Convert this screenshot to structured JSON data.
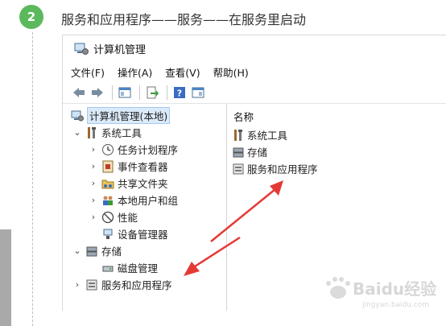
{
  "step": {
    "number": "2",
    "title": "服务和应用程序——服务——在服务里启动"
  },
  "window": {
    "title": "计算机管理",
    "menu": [
      "文件(F)",
      "操作(A)",
      "查看(V)",
      "帮助(H)"
    ]
  },
  "tree": {
    "root": "计算机管理(本地)",
    "system_tools": "系统工具",
    "task_scheduler": "任务计划程序",
    "event_viewer": "事件查看器",
    "shared_folders": "共享文件夹",
    "local_users": "本地用户和组",
    "performance": "性能",
    "device_manager": "设备管理器",
    "storage": "存储",
    "disk_management": "磁盘管理",
    "services_apps": "服务和应用程序"
  },
  "list": {
    "header": "名称",
    "items": [
      "系统工具",
      "存储",
      "服务和应用程序"
    ]
  },
  "watermark": {
    "text": "Baidu经验",
    "subtext": "jingyan.baidu.com"
  },
  "colors": {
    "badge": "#5cb85c",
    "arrow": "#e53935",
    "selection": "#dbeaf9"
  }
}
